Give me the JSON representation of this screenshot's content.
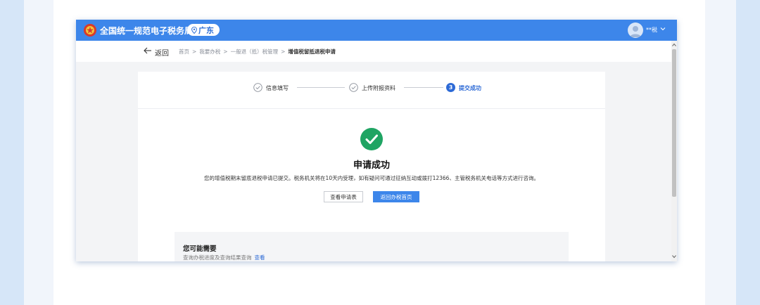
{
  "header": {
    "site_title": "全国统一规范电子税务局",
    "region": "广东",
    "user_name": "**税"
  },
  "breadcrumb": {
    "back_label": "返回",
    "items": [
      "首页",
      "我要办税",
      "一般退（抵）税管理",
      "增值税留抵退税申请"
    ]
  },
  "steps": [
    {
      "label": "信息填写",
      "status": "done"
    },
    {
      "label": "上传附报资料",
      "status": "done"
    },
    {
      "label": "提交成功",
      "status": "active",
      "number": "3"
    }
  ],
  "result": {
    "title": "申请成功",
    "description": "您的增值税期末留底退税申请已提交。税务机关将在10天内受理，如有疑问可通过征纳互动或拨打12366、主管税务机关电话等方式进行咨询。",
    "view_button": "查看申请表",
    "home_button": "返回办税首页"
  },
  "suggestions": {
    "title": "您可能需要",
    "row_text": "查询办税进度及查询结果查询",
    "row_link": "查看"
  },
  "colors": {
    "brand_blue": "#3d86ea",
    "success_green": "#1fa463",
    "active_step": "#2d6ad6"
  }
}
